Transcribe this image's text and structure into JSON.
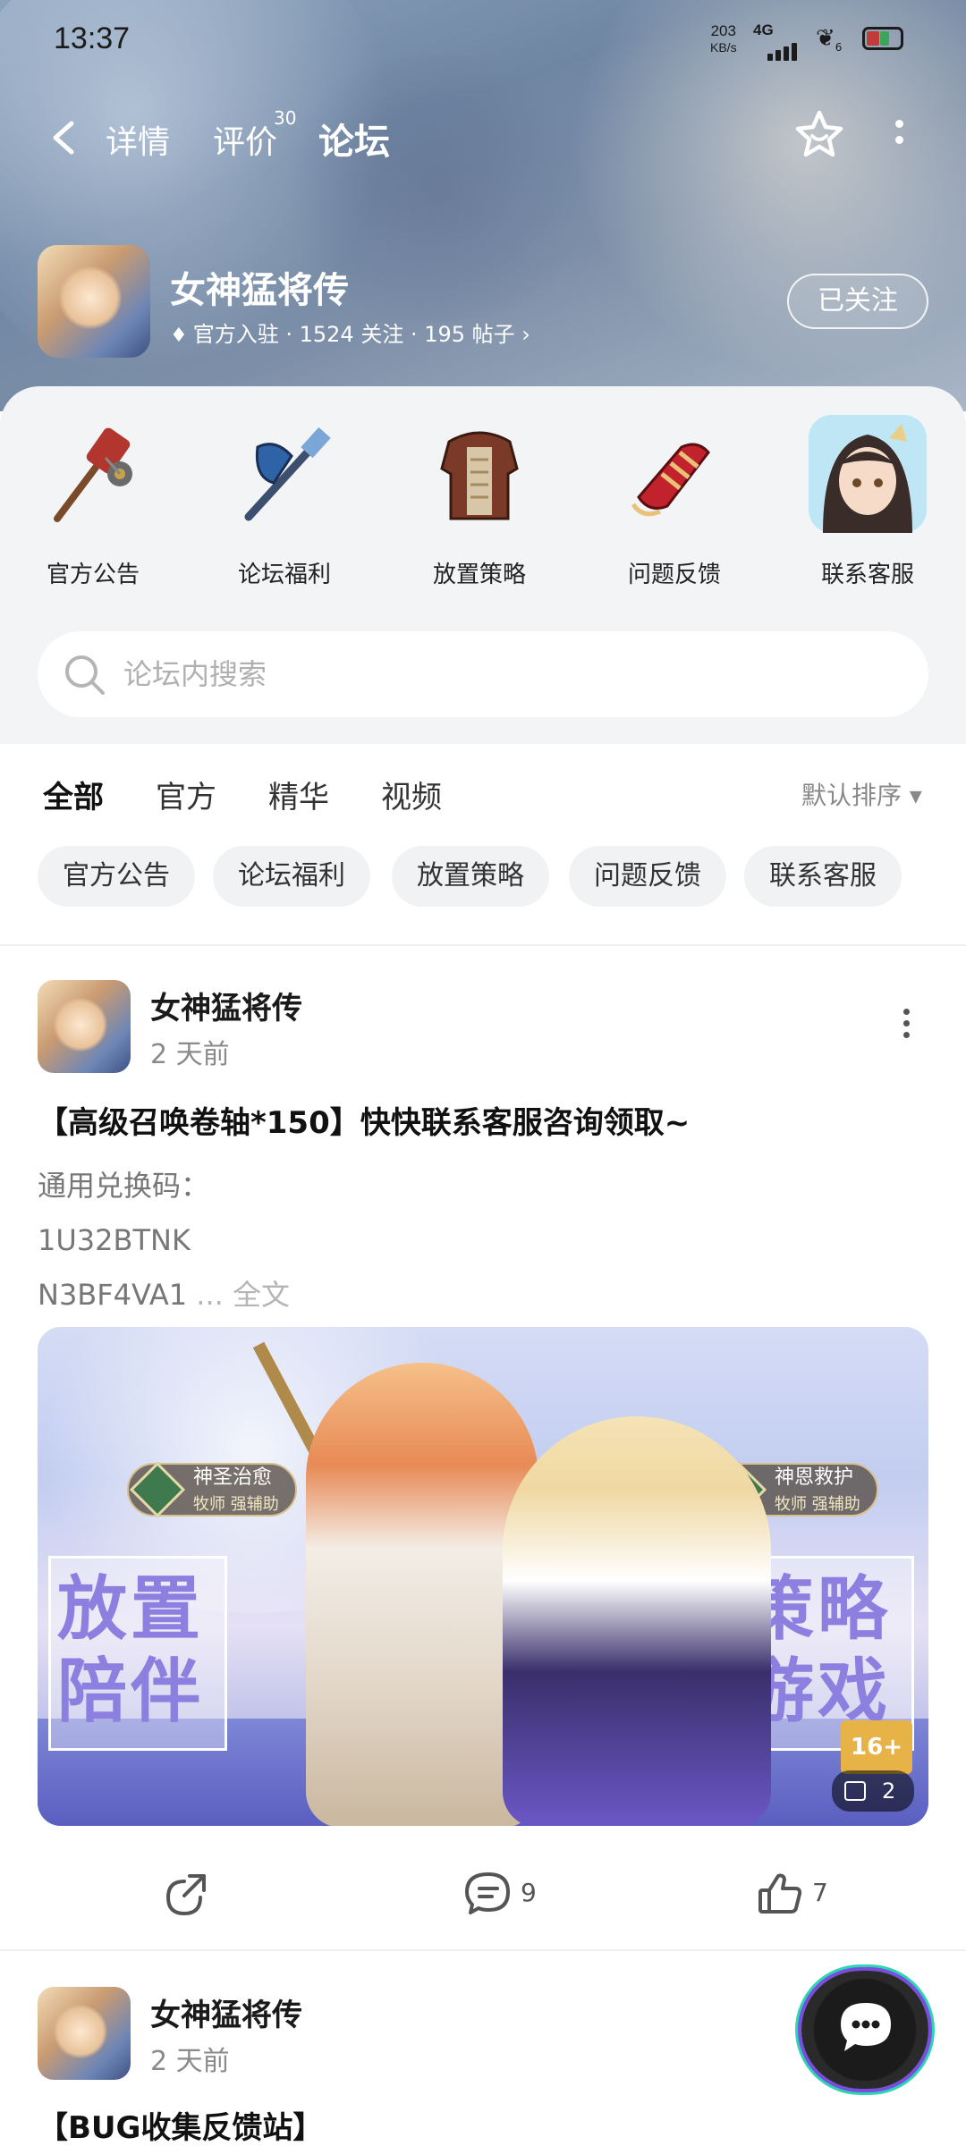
{
  "status_bar": {
    "time": "13:37",
    "speed_value": "203",
    "speed_unit": "KB/s",
    "network": "4G",
    "extra": "6"
  },
  "nav": {
    "tabs": [
      {
        "label": "详情"
      },
      {
        "label": "评价",
        "badge": "30"
      },
      {
        "label": "论坛"
      }
    ]
  },
  "game": {
    "name": "女神猛将传",
    "meta": "官方入驻 · 1524 关注 · 195 帖子",
    "follow_label": "已关注"
  },
  "categories": [
    {
      "label": "官方公告",
      "icon": "mace-icon"
    },
    {
      "label": "论坛福利",
      "icon": "axe-icon"
    },
    {
      "label": "放置策略",
      "icon": "armor-icon"
    },
    {
      "label": "问题反馈",
      "icon": "gauntlet-icon"
    },
    {
      "label": "联系客服",
      "icon": "portrait-icon"
    }
  ],
  "search": {
    "placeholder": "论坛内搜索"
  },
  "filters": {
    "tabs": [
      {
        "label": "全部"
      },
      {
        "label": "官方"
      },
      {
        "label": "精华"
      },
      {
        "label": "视频"
      }
    ],
    "sort_label": "默认排序"
  },
  "chips": [
    "官方公告",
    "论坛福利",
    "放置策略",
    "问题反馈",
    "联系客服"
  ],
  "posts": [
    {
      "author": "女神猛将传",
      "time": "2 天前",
      "title": "【高级召唤卷轴*150】快快联系客服咨询领取~",
      "body_lines": [
        "通用兑换码：",
        "1U32BTNK",
        "N3BF4VA1"
      ],
      "more_label": "... 全文",
      "image": {
        "left_text": "放置陪伴",
        "right_text": "策略游戏",
        "badge_left": "神圣治愈",
        "badge_left_sub": "牧师 强辅助",
        "badge_right": "神恩救护",
        "badge_right_sub": "牧师 强辅助",
        "age_label": "16+",
        "image_count": "2"
      },
      "comments": "9",
      "likes": "7"
    },
    {
      "author": "女神猛将传",
      "time": "2 天前",
      "title": "【BUG收集反馈站】"
    }
  ],
  "colors": {
    "accent": "#2fd4b4",
    "header_bg": "#7d8fa8"
  }
}
